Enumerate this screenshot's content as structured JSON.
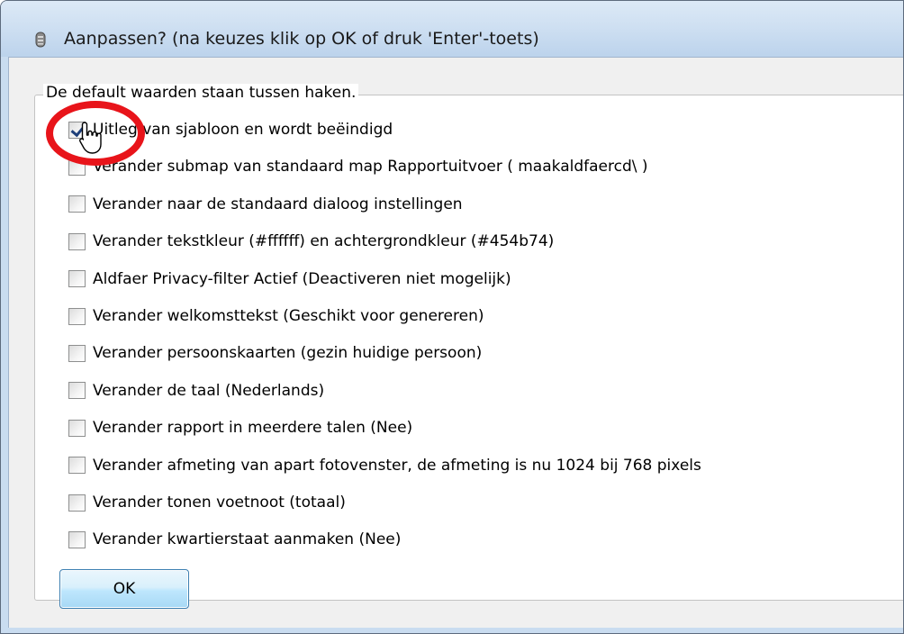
{
  "window": {
    "title": "Aanpassen? (na keuzes klik op OK of druk 'Enter'-toets)",
    "icon": "gear-icon"
  },
  "group": {
    "legend": "De default waarden staan tussen haken."
  },
  "options": [
    {
      "label": "Uitleg van sjabloon en wordt beëindigd",
      "checked": true
    },
    {
      "label": "Verander submap van standaard map Rapportuitvoer ( maakaldfaercd\\ )",
      "checked": false
    },
    {
      "label": "Verander naar de standaard dialoog instellingen",
      "checked": false
    },
    {
      "label": "Verander tekstkleur (#ffffff) en achtergrondkleur (#454b74)",
      "checked": false
    },
    {
      "label": "Aldfaer Privacy-filter Actief (Deactiveren niet mogelijk)",
      "checked": false
    },
    {
      "label": "Verander welkomsttekst (Geschikt voor genereren)",
      "checked": false
    },
    {
      "label": "Verander persoonskaarten (gezin huidige persoon)",
      "checked": false
    },
    {
      "label": "Verander de taal (Nederlands)",
      "checked": false
    },
    {
      "label": "Verander rapport in meerdere talen (Nee)",
      "checked": false
    },
    {
      "label": "Verander afmeting van apart fotovenster, de afmeting is nu 1024 bij 768 pixels",
      "checked": false
    },
    {
      "label": "Verander tonen voetnoot (totaal)",
      "checked": false
    },
    {
      "label": "Verander kwartierstaat aanmaken (Nee)",
      "checked": false
    }
  ],
  "buttons": {
    "ok_label": "OK"
  },
  "colors": {
    "highlight": "#e8141a",
    "checkmark": "#1e3f7a",
    "title_bar": "#cfe0f2"
  }
}
